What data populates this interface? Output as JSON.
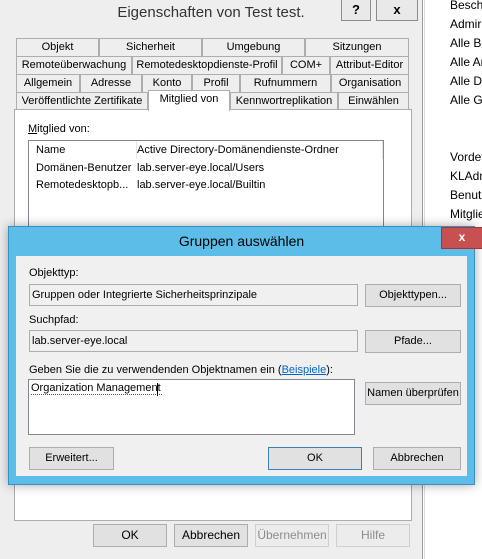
{
  "properties_window": {
    "title": "Eigenschaften von Test test.",
    "help_button": "?",
    "close_button": "x",
    "tabs_row1": [
      "Objekt",
      "Sicherheit",
      "Umgebung",
      "Sitzungen"
    ],
    "tabs_row2": [
      "Remoteüberwachung",
      "Remotedesktopdienste-Profil",
      "COM+",
      "Attribut-Editor"
    ],
    "tabs_row3": [
      "Allgemein",
      "Adresse",
      "Konto",
      "Profil",
      "Rufnummern",
      "Organisation"
    ],
    "tabs_row4": [
      "Veröffentlichte Zertifikate",
      "Mitglied von",
      "Kennwortreplikation",
      "Einwählen"
    ],
    "member_of_label": "Mitglied von:",
    "member_of_label_mnemonic": "M",
    "member_of_label_rest": "itglied von:",
    "columns": [
      "Name",
      "Active Directory-Domänendienste-Ordner"
    ],
    "rows": [
      {
        "name": "Domänen-Benutzer",
        "folder": "lab.server-eye.local/Users"
      },
      {
        "name": "Remotedesktopb...",
        "folder": "lab.server-eye.local/Builtin"
      }
    ],
    "buttons": {
      "ok": "OK",
      "cancel": "Abbrechen",
      "apply": "Übernehmen",
      "help": "Hilfe"
    }
  },
  "right_window": {
    "items_top": [
      "Beschr",
      "Admir",
      "Alle Be",
      "Alle An",
      "Alle De",
      "Alle Ga"
    ],
    "items_bottom": [
      "Vordef",
      "KLAdn",
      "Benutz",
      "Mitglie"
    ]
  },
  "select_groups_dialog": {
    "title": "Gruppen auswählen",
    "close_icon": "x",
    "object_type_label": "Objekttyp:",
    "object_type_value": "Gruppen oder Integrierte Sicherheitsprinzipale",
    "object_types_button": "Objekttypen...",
    "location_label": "Suchpfad:",
    "location_value": "lab.server-eye.local",
    "locations_button": "Pfade...",
    "enter_names_label_prefix": "Geben Sie die zu verwendenden Objektnamen ein (",
    "examples_link": "Beispiele",
    "enter_names_label_suffix": "):",
    "object_names_value": "Organization Management",
    "check_names_button": "Namen überprüfen",
    "advanced_button": "Erweitert...",
    "ok_button": "OK",
    "cancel_button": "Abbrechen"
  }
}
